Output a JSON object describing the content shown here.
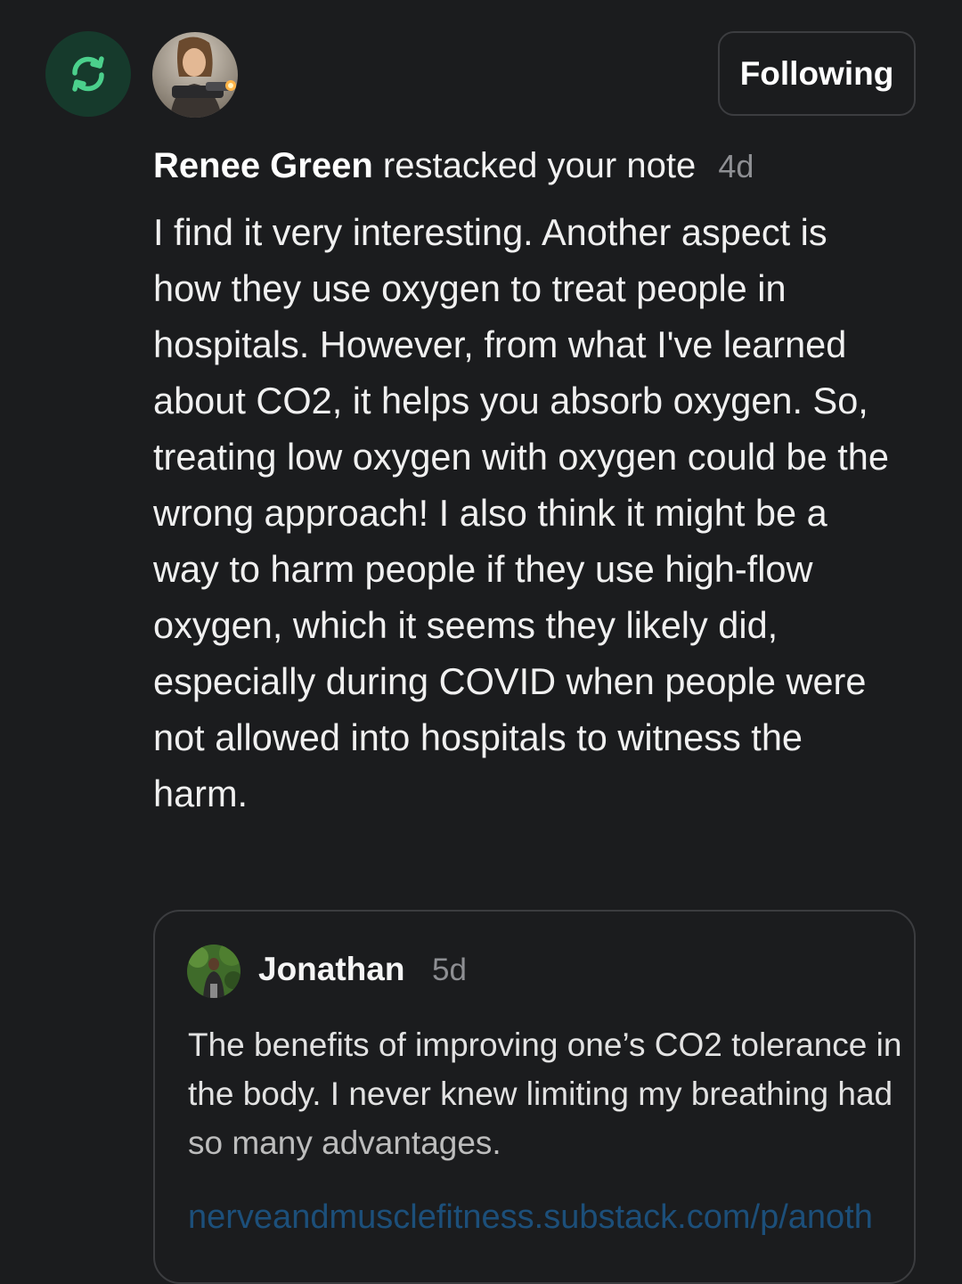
{
  "activity": {
    "icon": "restack-icon",
    "accent_color": "#4bd08c",
    "actor_name": "Renee Green",
    "action_text": "restacked your note",
    "time": "4d"
  },
  "follow_button": {
    "label": "Following"
  },
  "note": {
    "body": "I find it very interesting. Another aspect is how they use oxygen to treat people in hospitals. However, from what I've learned about CO2, it helps you absorb oxygen. So, treating low oxygen with oxygen could be the wrong approach! I also think it might be a way to harm people if they use high-flow oxygen, which it seems they likely did, especially during COVID when people were not allowed into hospitals to witness the harm."
  },
  "quoted_note": {
    "author": "Jonathan",
    "time": "5d",
    "lines": [
      "The benefits of improving one’s CO2 tolerance in",
      "the body. I never knew limiting my breathing had",
      "so many advantages."
    ],
    "link_text": "nerveandmusclefitness.substack.com/p/anoth",
    "link_color": "#1c4f7a"
  }
}
